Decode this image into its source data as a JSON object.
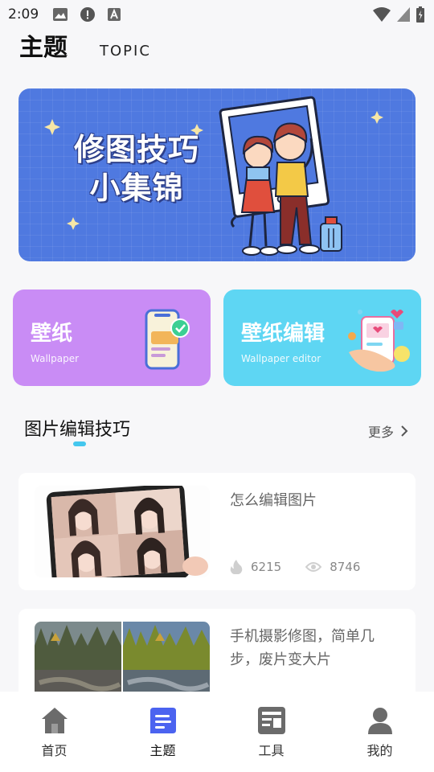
{
  "status_bar": {
    "time": "2:09"
  },
  "header": {
    "title": "主题",
    "subtitle": "TOPIC"
  },
  "banner": {
    "line1": "修图技巧",
    "line2": "小集锦"
  },
  "cards": [
    {
      "title": "壁纸",
      "subtitle": "Wallpaper",
      "color": "#c98cf5"
    },
    {
      "title": "壁纸编辑",
      "subtitle": "Wallpaper editor",
      "color": "#5ed6f3"
    }
  ],
  "section": {
    "title": "图片编辑技巧",
    "more_label": "更多"
  },
  "articles": [
    {
      "title": "怎么编辑图片",
      "likes": "6215",
      "views": "8746"
    },
    {
      "title": "手机摄影修图，简单几步，废片变大片"
    }
  ],
  "nav": {
    "items": [
      {
        "label": "首页",
        "icon": "home-icon"
      },
      {
        "label": "主题",
        "icon": "topic-icon",
        "active": true
      },
      {
        "label": "工具",
        "icon": "tools-icon"
      },
      {
        "label": "我的",
        "icon": "profile-icon"
      }
    ],
    "active_color": "#4b63f0",
    "inactive_color": "#666666"
  }
}
